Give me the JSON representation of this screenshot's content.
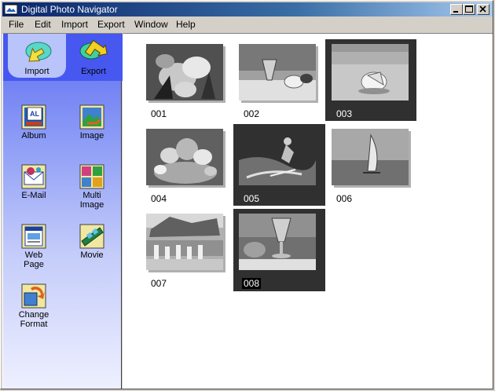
{
  "window": {
    "title": "Digital Photo Navigator"
  },
  "menu": [
    "File",
    "Edit",
    "Import",
    "Export",
    "Window",
    "Help"
  ],
  "sidebar": {
    "import_label": "Import",
    "export_label": "Export",
    "items": [
      {
        "label_lines": [
          "Album"
        ],
        "icon": "album-icon"
      },
      {
        "label_lines": [
          "Image"
        ],
        "icon": "image-icon"
      },
      {
        "label_lines": [
          "E-Mail"
        ],
        "icon": "email-icon"
      },
      {
        "label_lines": [
          "Multi",
          "Image"
        ],
        "icon": "multi-image-icon"
      },
      {
        "label_lines": [
          "Web",
          "Page"
        ],
        "icon": "web-page-icon"
      },
      {
        "label_lines": [
          "Movie"
        ],
        "icon": "movie-icon"
      },
      {
        "label_lines": [
          "Change",
          "Format"
        ],
        "icon": "change-format-icon"
      }
    ]
  },
  "thumbnails": [
    {
      "label": "001",
      "subject": "flowers",
      "selected": false
    },
    {
      "label": "002",
      "subject": "drink-on-beach",
      "selected": false
    },
    {
      "label": "003",
      "subject": "shell-on-sand",
      "selected": true
    },
    {
      "label": "004",
      "subject": "fruit-basket",
      "selected": false
    },
    {
      "label": "005",
      "subject": "water-skier",
      "selected": true
    },
    {
      "label": "006",
      "subject": "sailboard",
      "selected": false
    },
    {
      "label": "007",
      "subject": "dancers",
      "selected": false
    },
    {
      "label": "008",
      "subject": "cocktail",
      "selected": true
    }
  ],
  "colors": {
    "title_start": "#0a246a",
    "title_end": "#a6caf0",
    "sidebar_top": "#4658f0",
    "selection": "#303030"
  }
}
